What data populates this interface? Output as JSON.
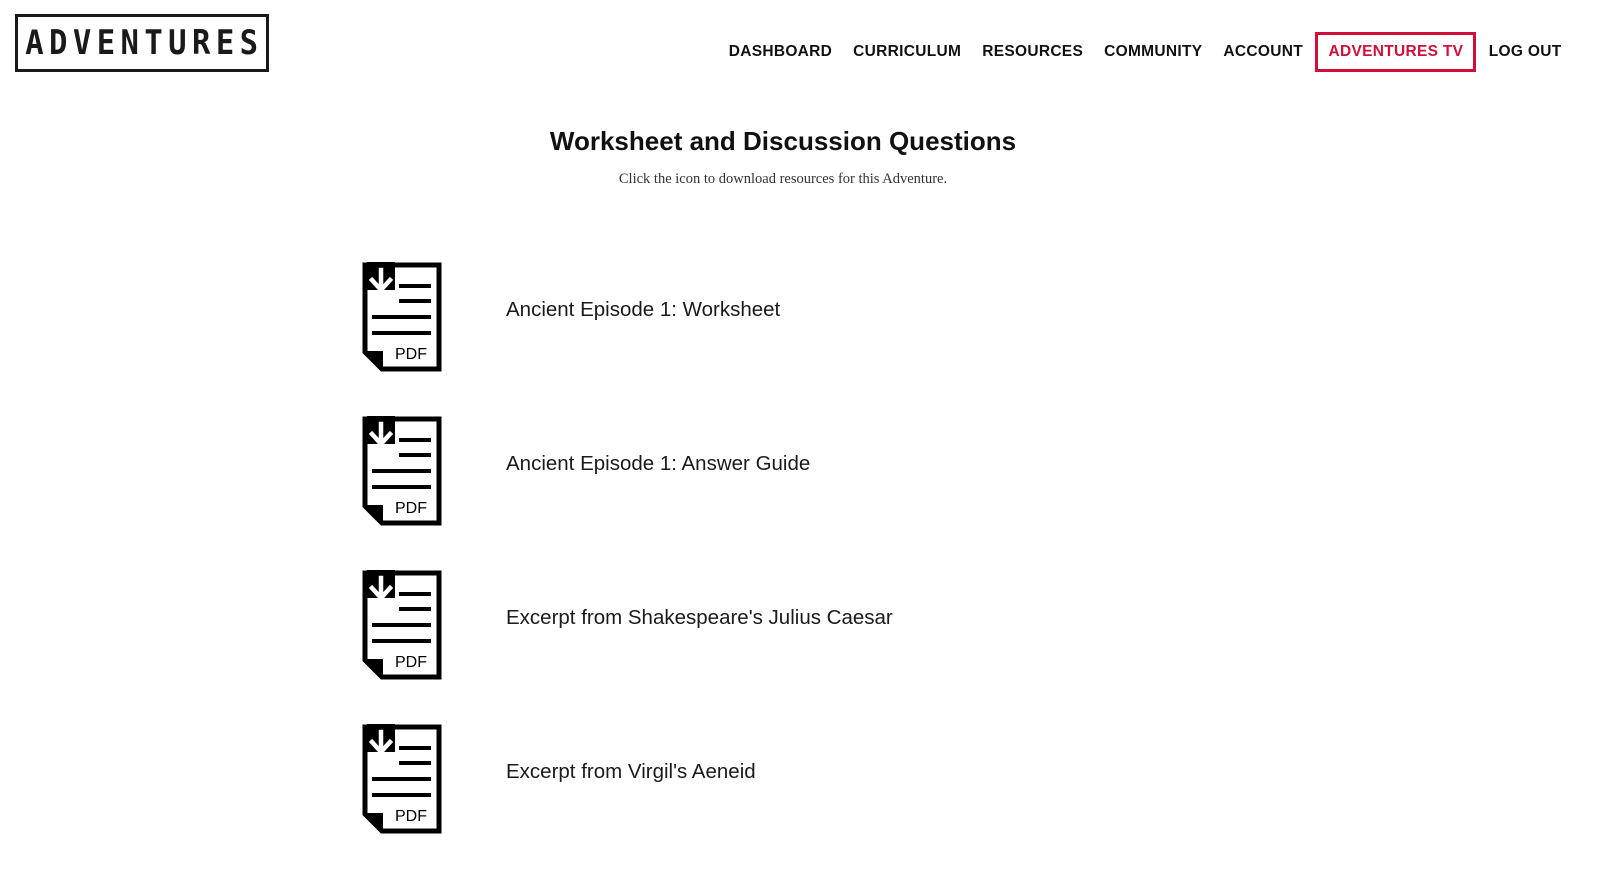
{
  "header": {
    "logo_text": "ADVENTURES",
    "nav": [
      {
        "label": "DASHBOARD"
      },
      {
        "label": "CURRICULUM"
      },
      {
        "label": "RESOURCES"
      },
      {
        "label": "COMMUNITY"
      },
      {
        "label": "ACCOUNT"
      },
      {
        "label": "ADVENTURES TV",
        "highlighted": true
      },
      {
        "label": "LOG OUT"
      }
    ]
  },
  "main": {
    "title": "Worksheet and Discussion Questions",
    "subtitle": "Click the icon to download resources for this Adventure.",
    "resources": [
      {
        "icon": "pdf-download-icon",
        "icon_text": "PDF",
        "label": "Ancient Episode 1: Worksheet"
      },
      {
        "icon": "pdf-download-icon",
        "icon_text": "PDF",
        "label": "Ancient Episode 1: Answer Guide"
      },
      {
        "icon": "pdf-download-icon",
        "icon_text": "PDF",
        "label": "Excerpt from Shakespeare's Julius Caesar"
      },
      {
        "icon": "pdf-download-icon",
        "icon_text": "PDF",
        "label": "Excerpt from Virgil's Aeneid"
      }
    ]
  },
  "colors": {
    "accent": "#d0103a",
    "text": "#111111",
    "background": "#ffffff"
  }
}
